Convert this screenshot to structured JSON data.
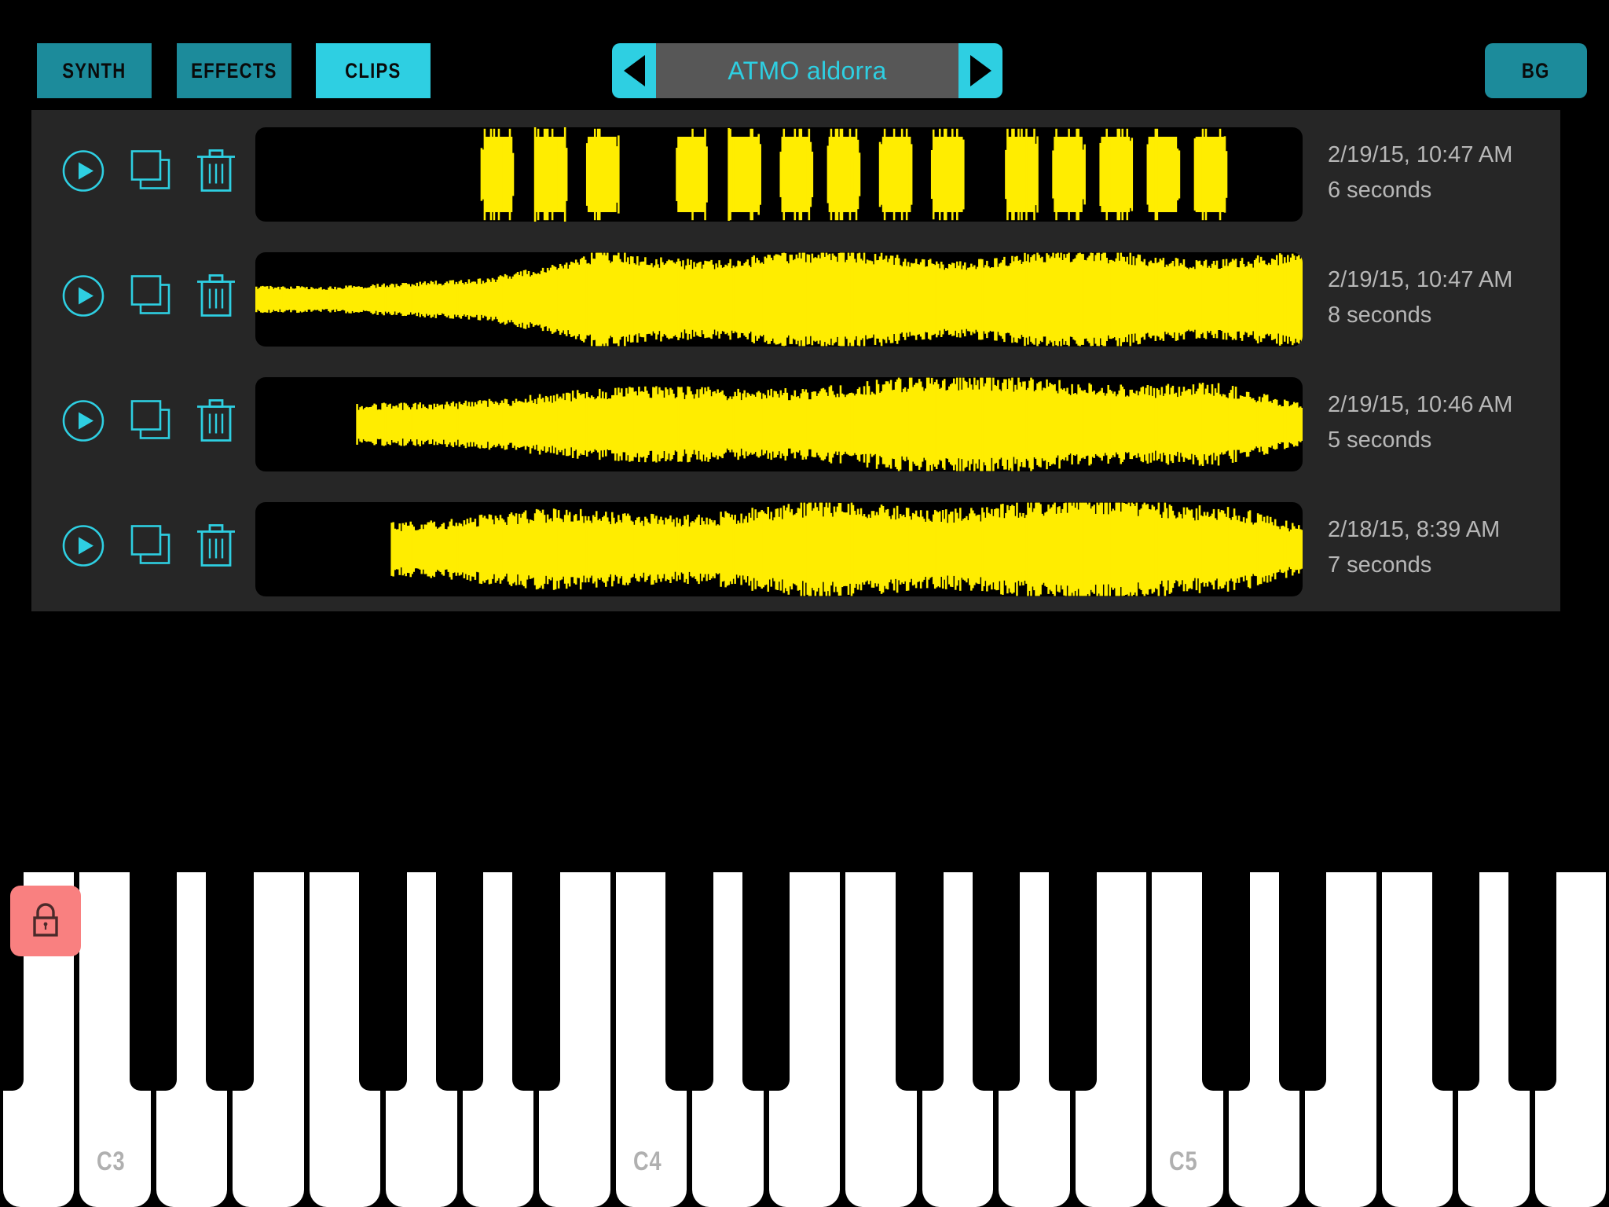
{
  "app": {
    "accent_cyan": "#2ecfe2",
    "accent_teal": "#1c8b9b",
    "waveform_color": "#ffed00",
    "panel_bg": "#262626",
    "lock_bg": "#f98080"
  },
  "topbar": {
    "tabs": [
      {
        "label": "SYNTH",
        "active": false
      },
      {
        "label": "EFFECTS",
        "active": false
      },
      {
        "label": "CLIPS",
        "active": true
      }
    ],
    "preset": {
      "name": "ATMO aldorra",
      "prev_icon": "triangle-left-icon",
      "next_icon": "triangle-right-icon"
    },
    "bg_button": {
      "label": "BG"
    }
  },
  "clips": {
    "row_icons": {
      "play": "play-circle-icon",
      "duplicate": "duplicate-icon",
      "delete": "trash-icon"
    },
    "items": [
      {
        "date": "2/19/15, 10:47 AM",
        "duration": "6 seconds"
      },
      {
        "date": "2/19/15, 10:47 AM",
        "duration": "8 seconds"
      },
      {
        "date": "2/19/15, 10:46 AM",
        "duration": "5 seconds"
      },
      {
        "date": "2/18/15, 8:39 AM",
        "duration": "7 seconds"
      }
    ]
  },
  "keyboard": {
    "lock_icon": "lock-icon",
    "octave_labels": [
      "C3",
      "C4",
      "C5"
    ]
  }
}
